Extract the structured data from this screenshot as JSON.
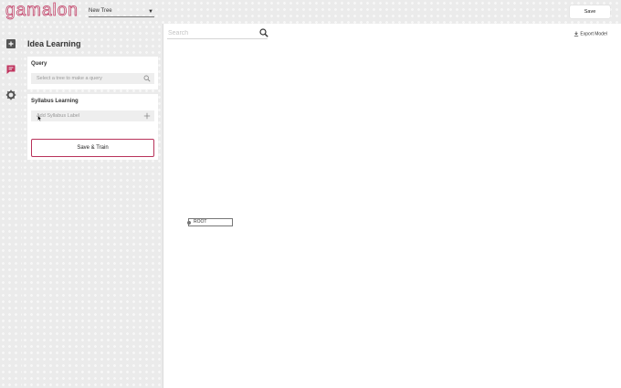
{
  "app": {
    "logo_text": "gamalon",
    "brand_color": "#c0355f"
  },
  "header": {
    "tree_select": {
      "selected": "New Tree",
      "icon": "chevron-down-icon"
    },
    "save_label": "Save"
  },
  "rail": {
    "items": [
      {
        "icon": "add-box-icon"
      },
      {
        "icon": "idea-learning-icon",
        "active": true
      },
      {
        "icon": "gear-icon"
      }
    ]
  },
  "sidebar": {
    "title": "Idea Learning",
    "query": {
      "label": "Query",
      "placeholder": "Select a tree to make a query",
      "icon": "search-icon"
    },
    "syllabus": {
      "label": "Syllabus Learning",
      "placeholder": "Add Syllabus Label",
      "icon": "plus-icon",
      "save_train_label": "Save & Train"
    }
  },
  "main": {
    "search": {
      "placeholder": "Search",
      "icon": "search-icon"
    },
    "export_label": "Export Model",
    "root_node_label": "ROOT"
  }
}
